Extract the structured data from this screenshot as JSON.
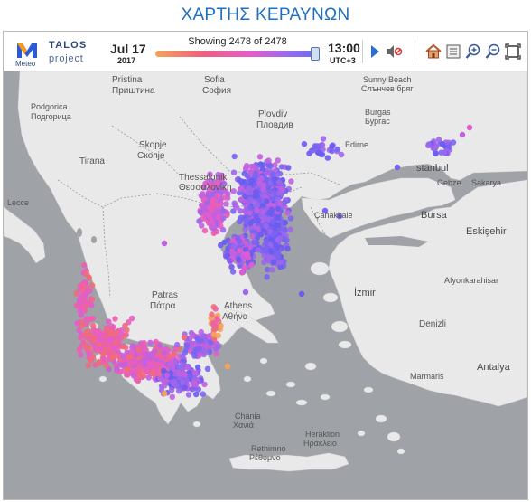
{
  "page": {
    "title": "ΧΑΡΤΗΣ ΚΕΡΑΥΝΩΝ"
  },
  "toolbar": {
    "logo": {
      "mark_text": "Meteo",
      "talos": "TALOS",
      "project": "project"
    },
    "date": {
      "day": "Jul 17",
      "year": "2017"
    },
    "showing": "Showing 2478 of 2478",
    "time": {
      "value": "13:00",
      "timezone": "UTC+3"
    },
    "slider_position": 1.0,
    "buttons": [
      "play-icon",
      "sound-muted-icon",
      "home-icon",
      "fullscreen-list-icon",
      "zoom-in-icon",
      "zoom-out-icon",
      "expand-icon"
    ]
  },
  "colors": {
    "title": "#1f6fc0",
    "sea": "#9fa3a7",
    "land": "#e9e9e9",
    "strike_old": "#f6a35a",
    "strike_mid": "#e45ccc",
    "strike_new": "#6a5cf0"
  },
  "map": {
    "labels": {
      "sofia": "София",
      "sofia_prefix": "Sofia",
      "pristina": "Pristina",
      "pristina_cyr": "Приштина",
      "podgorica": "Podgorica",
      "podgorica_cyr": "Подгорица",
      "skopje": "Skopje",
      "skopje_cyr": "Скопје",
      "tirana": "Tirana",
      "plovdiv": "Plovdiv",
      "plovdiv_cyr": "Пловдив",
      "sunny_beach": "Sunny Beach",
      "sunny_beach_cyr": "Слънчев бряг",
      "burgas": "Burgas",
      "burgas_cyr": "Бургас",
      "edirne": "Edirne",
      "istanbul": "Istanbul",
      "gebze": "Gebze",
      "sakarya": "Sakarya",
      "thessaloniki": "Thessaloniki",
      "thessaloniki_gr": "Θεσσαλονίκη",
      "canakkale": "Çanakkale",
      "bursa": "Bursa",
      "eskisehir": "Eskişehir",
      "lecce": "Lecce",
      "patras": "Patras",
      "patras_gr": "Πάτρα",
      "athens": "Athens",
      "athens_gr": "Αθήνα",
      "izmir": "İzmir",
      "afyonkarahisar": "Afyonkarahisar",
      "denizli": "Denizli",
      "marmaris": "Marmaris",
      "antalya": "Antalya",
      "chania": "Chania",
      "chania_gr": "Χανιά",
      "heraklion": "Heraklion",
      "heraklion_gr": "Ηράκλειο",
      "rethimno": "Rethimno",
      "rethimno_gr": "Ρέθυμνο"
    }
  }
}
